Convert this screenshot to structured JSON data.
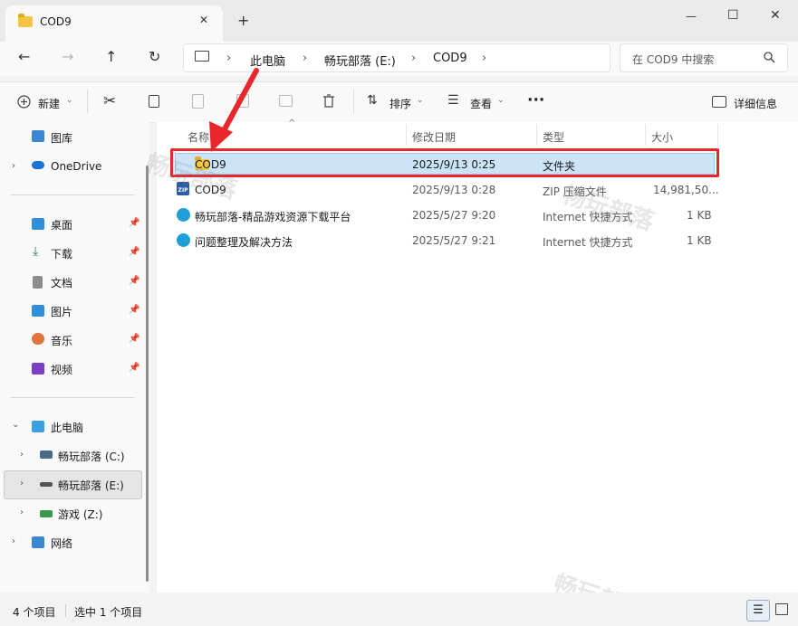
{
  "window": {
    "tab_title": "COD9",
    "new_tab": "+",
    "minimize": "—",
    "maximize": "☐",
    "close": "✕"
  },
  "nav": {
    "back": "←",
    "forward": "→",
    "up": "↑",
    "refresh": "↻"
  },
  "breadcrumb": {
    "items": [
      "此电脑",
      "畅玩部落 (E:)",
      "COD9"
    ],
    "separator": "›"
  },
  "search": {
    "placeholder": "在 COD9 中搜索"
  },
  "toolbar": {
    "new_label": "新建",
    "sort_label": "排序",
    "view_label": "查看",
    "more": "···",
    "details_label": "详细信息"
  },
  "sidebar": {
    "gallery": "图库",
    "onedrive": "OneDrive",
    "quick": [
      "桌面",
      "下载",
      "文档",
      "图片",
      "音乐",
      "视频"
    ],
    "this_pc": "此电脑",
    "drives": [
      "畅玩部落 (C:)",
      "畅玩部落 (E:)",
      "游戏 (Z:)"
    ],
    "network": "网络"
  },
  "columns": {
    "name": "名称",
    "date": "修改日期",
    "type": "类型",
    "size": "大小"
  },
  "files": [
    {
      "name": "COD9",
      "date": "2025/9/13 0:25",
      "type": "文件夹",
      "size": ""
    },
    {
      "name": "COD9",
      "date": "2025/9/13 0:28",
      "type": "ZIP 压缩文件",
      "size": "14,981,50..."
    },
    {
      "name": "畅玩部落-精品游戏资源下载平台",
      "date": "2025/5/27 9:20",
      "type": "Internet 快捷方式",
      "size": "1 KB"
    },
    {
      "name": "问题整理及解决方法",
      "date": "2025/5/27 9:21",
      "type": "Internet 快捷方式",
      "size": "1 KB"
    }
  ],
  "status": {
    "count": "4 个项目",
    "selected": "选中 1 个项目"
  },
  "watermark": "畅玩部落",
  "colors": {
    "highlight": "#e8262b",
    "selection": "#cce4f7",
    "accent": "#0067c0"
  }
}
